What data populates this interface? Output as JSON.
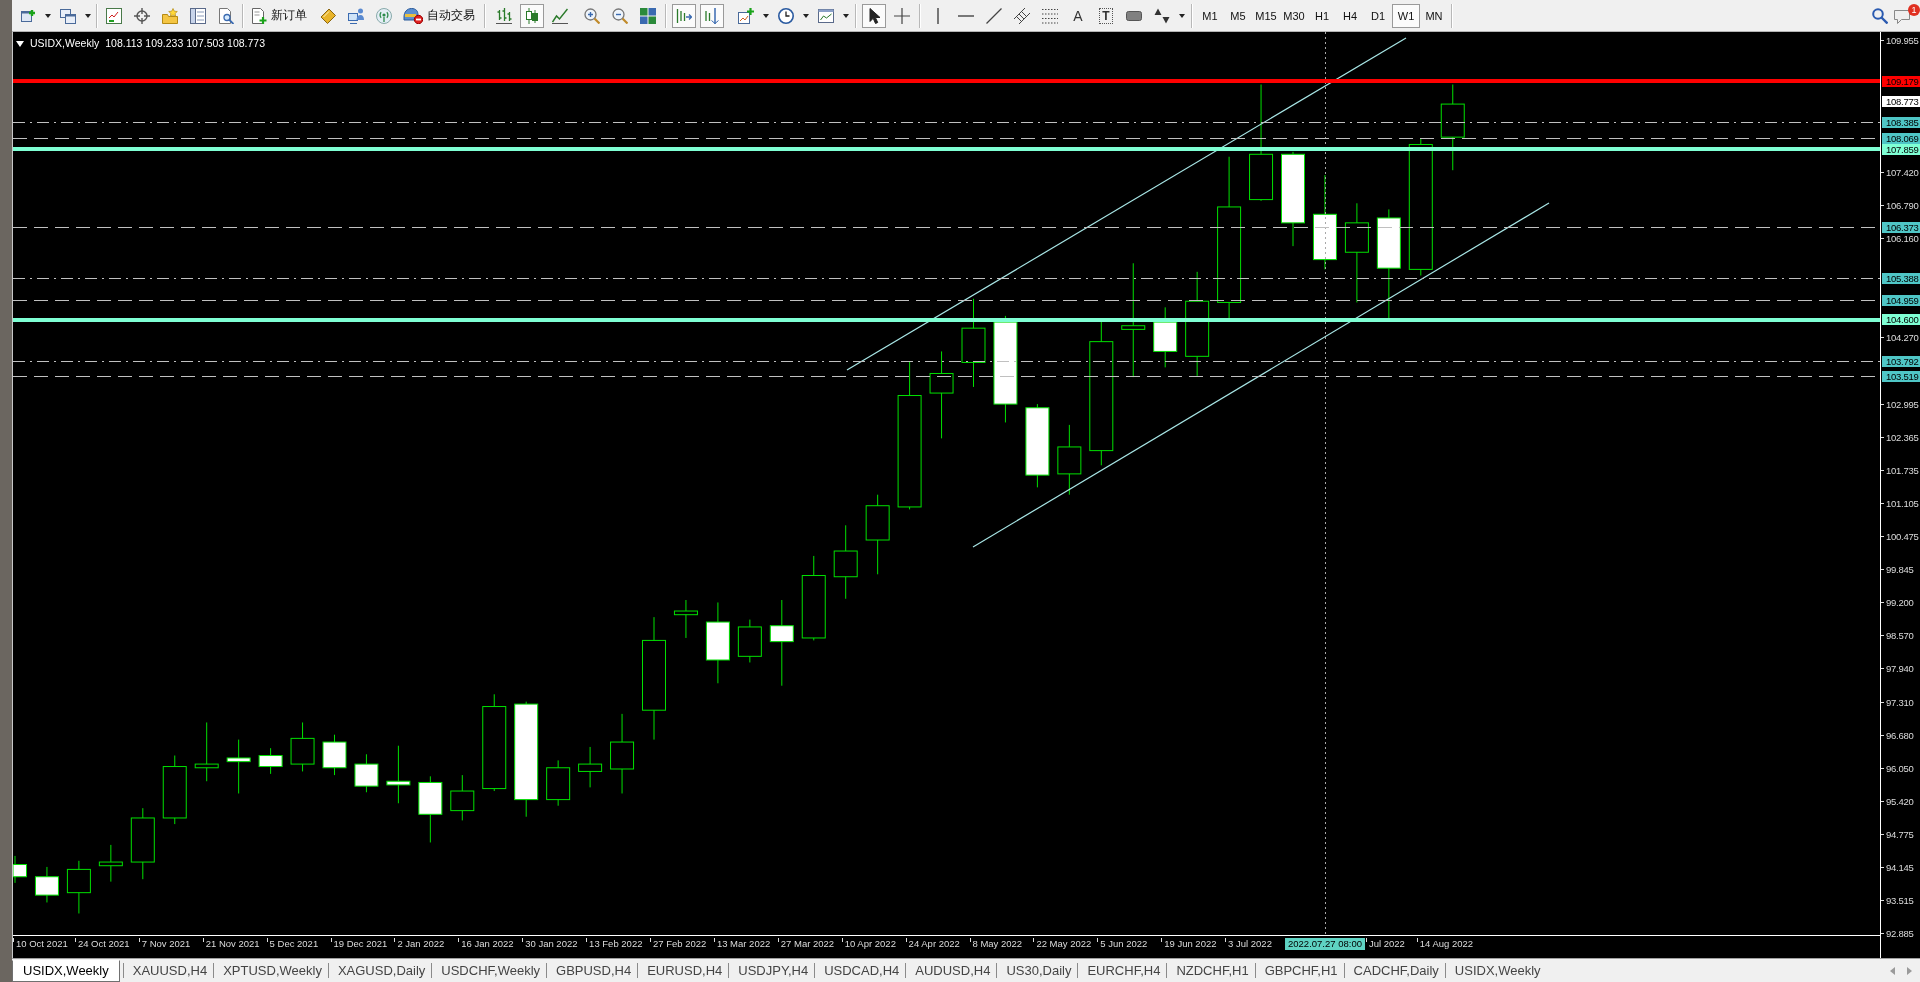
{
  "toolbar": {
    "order_buttons": [
      "新订单",
      "自动交易"
    ],
    "chart_types": [
      {
        "selected": false
      },
      {
        "selected": true
      },
      {
        "selected": false
      }
    ],
    "chart_options": [
      {
        "on": true
      },
      {
        "on": true
      }
    ],
    "pointer_tools": [
      {
        "selected": true
      },
      {
        "selected": false
      }
    ],
    "text_tools": [
      "A",
      "T"
    ],
    "timeframes": [
      {
        "label": "M1",
        "selected": false
      },
      {
        "label": "M5",
        "selected": false
      },
      {
        "label": "M15",
        "selected": false
      },
      {
        "label": "M30",
        "selected": false
      },
      {
        "label": "H1",
        "selected": false
      },
      {
        "label": "H4",
        "selected": false
      },
      {
        "label": "D1",
        "selected": false
      },
      {
        "label": "W1",
        "selected": true
      },
      {
        "label": "MN",
        "selected": false
      }
    ],
    "notification_count": "1"
  },
  "chart": {
    "symbol": "USIDX,Weekly",
    "ohlc": "108.113 109.233 107.503 108.773",
    "price_ticks": [
      "109.955",
      "107.420",
      "106.790",
      "106.160",
      "104.270",
      "102.995",
      "102.365",
      "101.735",
      "101.105",
      "100.475",
      "99.845",
      "99.200",
      "98.570",
      "97.940",
      "97.310",
      "96.680",
      "96.050",
      "95.420",
      "94.775",
      "94.145",
      "93.515",
      "92.885"
    ],
    "price_lines": [
      {
        "label": "109.179",
        "kind": "solid",
        "color": "#ff0000"
      },
      {
        "label": "108.385",
        "kind": "dash-dot",
        "color": "#c0c0c0"
      },
      {
        "label": "108.069",
        "kind": "dashed",
        "color": "#c0c0c0"
      },
      {
        "label": "107.859",
        "kind": "solid",
        "color": "#7fffd4"
      },
      {
        "label": "106.373",
        "kind": "dashed",
        "color": "#c0c0c0"
      },
      {
        "label": "105.388",
        "kind": "dash-dot",
        "color": "#c0c0c0"
      },
      {
        "label": "104.959",
        "kind": "dashed",
        "color": "#c0c0c0"
      },
      {
        "label": "104.600",
        "kind": "solid",
        "color": "#7fffd4"
      },
      {
        "label": "103.792",
        "kind": "dash-dot",
        "color": "#c0c0c0"
      },
      {
        "label": "103.519",
        "kind": "dashed",
        "color": "#c0c0c0"
      }
    ],
    "current_price": "108.773",
    "crosshair_time": "2022.07.27 08:00",
    "date_labels": [
      "10 Oct 2021",
      "24 Oct 2021",
      "7 Nov 2021",
      "21 Nov 2021",
      "5 Dec 2021",
      "19 Dec 2021",
      "2 Jan 2022",
      "16 Jan 2022",
      "30 Jan 2022",
      "13 Feb 2022",
      "27 Feb 2022",
      "13 Mar 2022",
      "27 Mar 2022",
      "10 Apr 2022",
      "24 Apr 2022",
      "8 May 2022",
      "22 May 2022",
      "5 Jun 2022",
      "19 Jun 2022",
      "3 Jul 2022",
      "Jul 2022",
      "14 Aug 2022"
    ]
  },
  "tabs": [
    {
      "label": "USIDX,Weekly",
      "selected": true
    },
    {
      "label": "XAUUSD,H4",
      "selected": false
    },
    {
      "label": "XPTUSD,Weekly",
      "selected": false
    },
    {
      "label": "XAGUSD,Daily",
      "selected": false
    },
    {
      "label": "USDCHF,Weekly",
      "selected": false
    },
    {
      "label": "GBPUSD,H4",
      "selected": false
    },
    {
      "label": "EURUSD,H4",
      "selected": false
    },
    {
      "label": "USDJPY,H4",
      "selected": false
    },
    {
      "label": "USDCAD,H4",
      "selected": false
    },
    {
      "label": "AUDUSD,H4",
      "selected": false
    },
    {
      "label": "US30,Daily",
      "selected": false
    },
    {
      "label": "EURCHF,H4",
      "selected": false
    },
    {
      "label": "NZDCHF,H1",
      "selected": false
    },
    {
      "label": "GBPCHF,H1",
      "selected": false
    },
    {
      "label": "CADCHF,Daily",
      "selected": false
    },
    {
      "label": "USIDX,Weekly",
      "selected": false
    }
  ]
}
